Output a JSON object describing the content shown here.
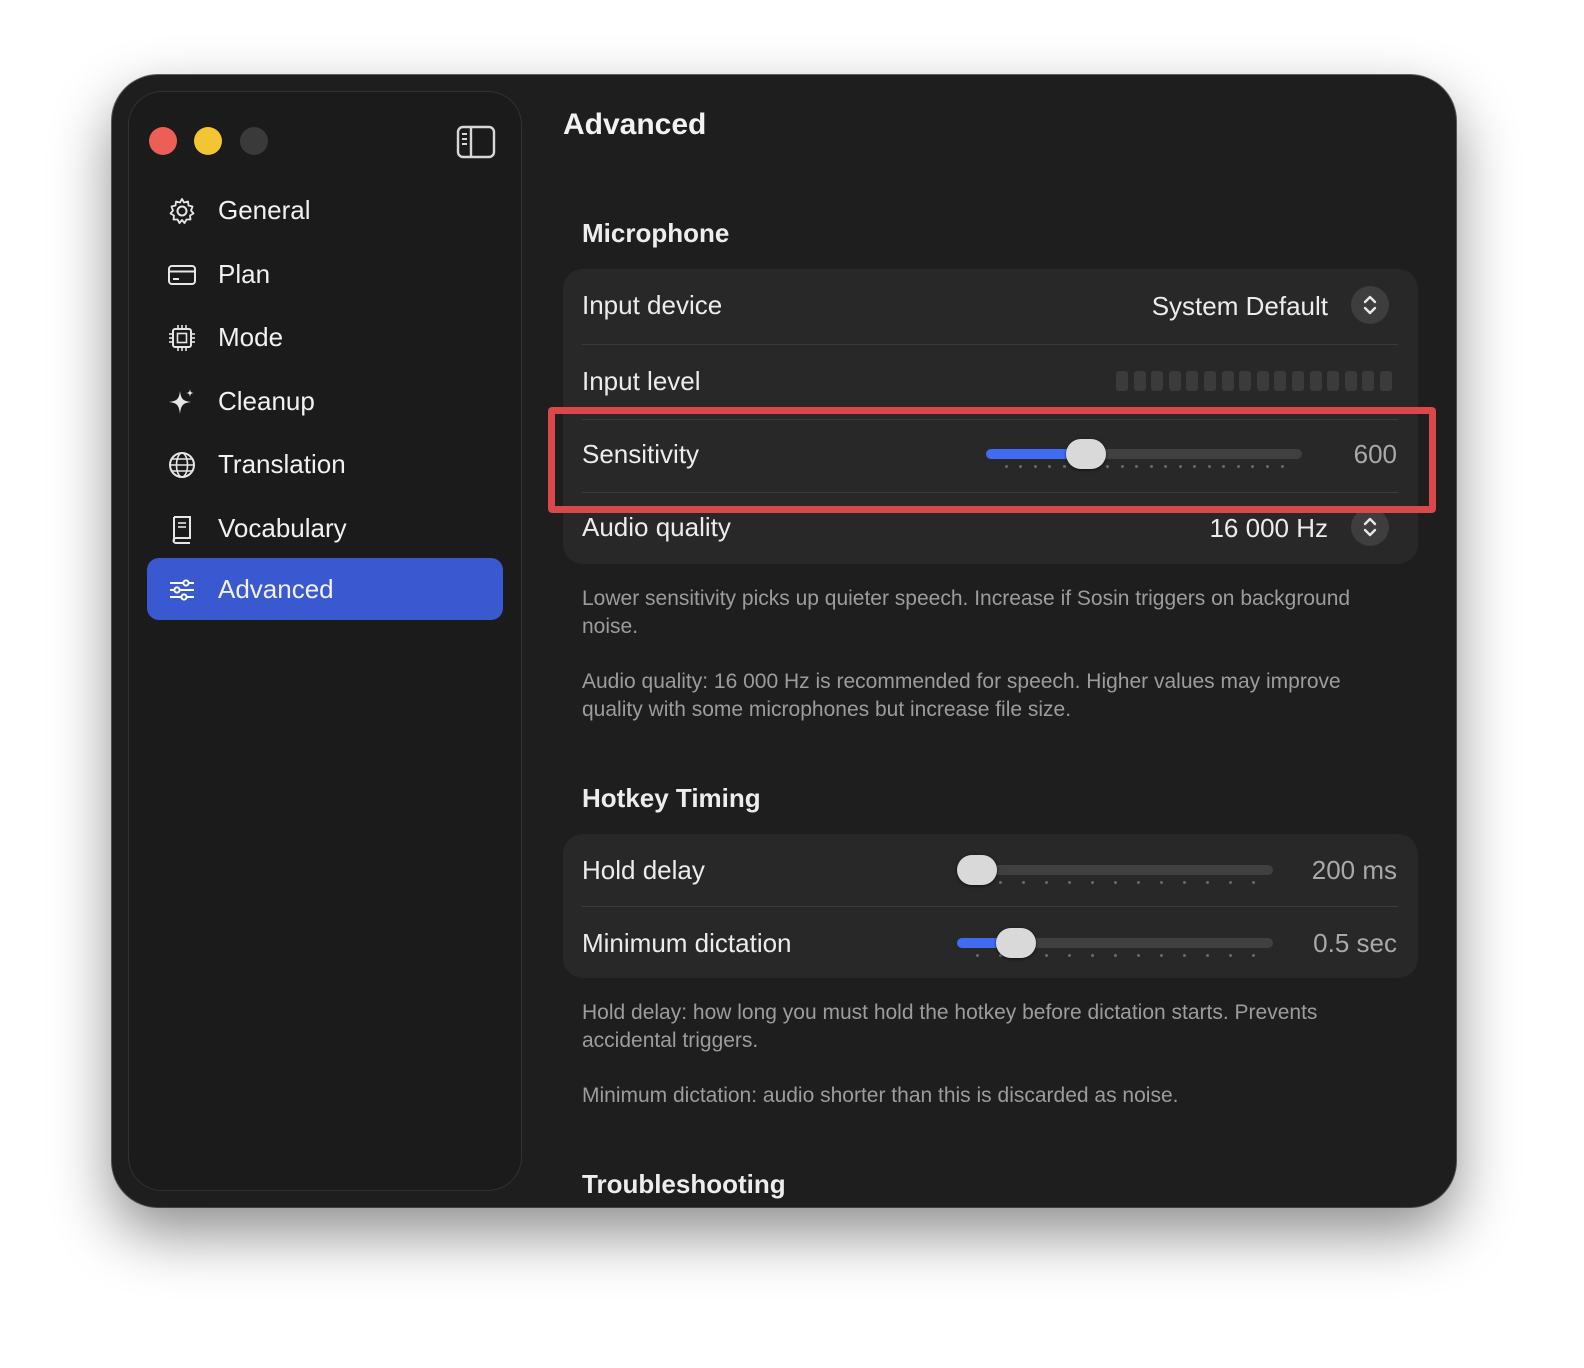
{
  "sidebar": {
    "toggle_icon": "sidebar-toggle-icon",
    "items": [
      {
        "label": "General",
        "icon": "gear-icon"
      },
      {
        "label": "Plan",
        "icon": "credit-card-icon"
      },
      {
        "label": "Mode",
        "icon": "cpu-icon"
      },
      {
        "label": "Cleanup",
        "icon": "sparkle-icon"
      },
      {
        "label": "Translation",
        "icon": "globe-icon"
      },
      {
        "label": "Vocabulary",
        "icon": "book-icon"
      },
      {
        "label": "Advanced",
        "icon": "sliders-icon",
        "active": true
      }
    ]
  },
  "page": {
    "title": "Advanced"
  },
  "microphone": {
    "title": "Microphone",
    "input_device": {
      "label": "Input device",
      "value": "System Default"
    },
    "input_level": {
      "label": "Input level",
      "level": 0
    },
    "sensitivity": {
      "label": "Sensitivity",
      "value": "600",
      "fraction": 0.29
    },
    "audio_quality": {
      "label": "Audio quality",
      "value": "16 000 Hz"
    },
    "help1": "Lower sensitivity picks up quieter speech. Increase if Sosin triggers on background noise.",
    "help2": "Audio quality: 16 000 Hz is recommended for speech. Higher values may improve quality with some microphones but increase file size."
  },
  "hotkey": {
    "title": "Hotkey Timing",
    "hold_delay": {
      "label": "Hold delay",
      "value": "200 ms",
      "fraction": 0.0
    },
    "min_dictation": {
      "label": "Minimum dictation",
      "value": "0.5 sec",
      "fraction": 0.14
    },
    "help1": "Hold delay: how long you must hold the hotkey before dictation starts. Prevents accidental triggers.",
    "help2": "Minimum dictation: audio shorter than this is discarded as noise."
  },
  "troubleshooting": {
    "title": "Troubleshooting"
  },
  "colors": {
    "accent": "#3a59d1",
    "slider_fill": "#3f6cf2",
    "highlight": "#d9484a"
  }
}
